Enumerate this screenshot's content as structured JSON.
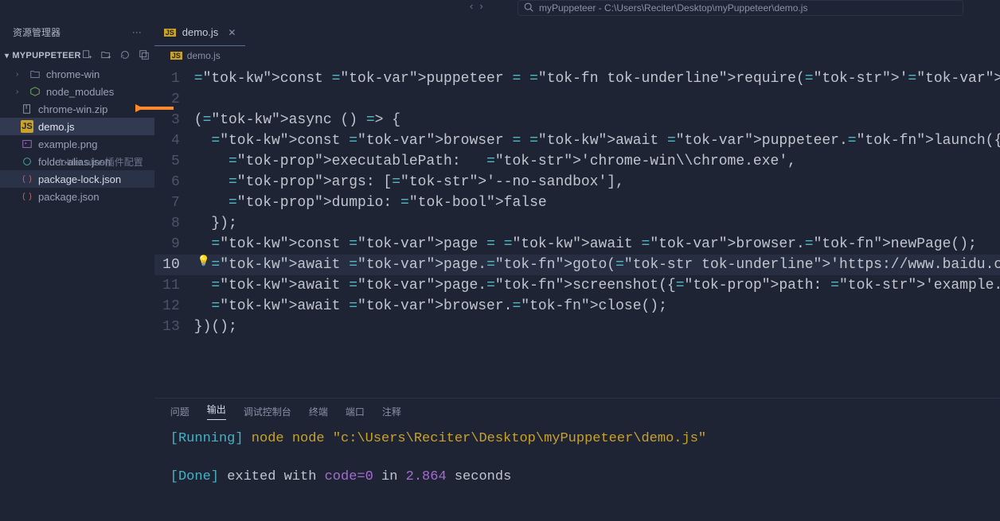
{
  "top": {
    "path_icon": "search-icon",
    "path_text": "myPuppeteer - C:\\Users\\Reciter\\Desktop\\myPuppeteer\\demo.js"
  },
  "sidebar": {
    "title": "资源管理器",
    "project": "MYPUPPETEER",
    "actions": [
      "new-file",
      "new-folder",
      "refresh",
      "collapse-all"
    ],
    "items": [
      {
        "type": "folder",
        "name": "chrome-win",
        "icon": "folder"
      },
      {
        "type": "folder",
        "name": "node_modules",
        "icon": "nm"
      },
      {
        "type": "file",
        "name": "chrome-win.zip",
        "icon": "zip",
        "annotated": true
      },
      {
        "type": "file",
        "name": "demo.js",
        "icon": "js",
        "selected": true
      },
      {
        "type": "file",
        "name": "example.png",
        "icon": "png"
      },
      {
        "type": "file",
        "name": "folder-alias.json",
        "icon": "json",
        "hint": "folder alias插件配置"
      },
      {
        "type": "file",
        "name": "package-lock.json",
        "icon": "json2",
        "active": true
      },
      {
        "type": "file",
        "name": "package.json",
        "icon": "json2"
      }
    ]
  },
  "tabs": {
    "open": [
      {
        "label": "demo.js",
        "icon": "js",
        "active": true
      }
    ]
  },
  "breadcrumb": {
    "icon": "js",
    "text": "demo.js"
  },
  "code": {
    "lines": [
      {
        "n": 1,
        "t": "const puppeteer = require('puppeteer');"
      },
      {
        "n": 2,
        "t": ""
      },
      {
        "n": 3,
        "t": "(async () => {"
      },
      {
        "n": 4,
        "t": "  const browser = await puppeteer.launch({"
      },
      {
        "n": 5,
        "t": "    executablePath:   'chrome-win\\\\chrome.exe',"
      },
      {
        "n": 6,
        "t": "    args: ['--no-sandbox'],"
      },
      {
        "n": 7,
        "t": "    dumpio: false"
      },
      {
        "n": 8,
        "t": "  });"
      },
      {
        "n": 9,
        "t": "  const page = await browser.newPage();"
      },
      {
        "n": 10,
        "t": "  await page.goto('https://www.baidu.com');",
        "highlight": true
      },
      {
        "n": 11,
        "t": "  await page.screenshot({path: 'example.png'});"
      },
      {
        "n": 12,
        "t": "  await browser.close();"
      },
      {
        "n": 13,
        "t": "})();"
      }
    ]
  },
  "panel": {
    "tabs": [
      "问题",
      "输出",
      "调试控制台",
      "终端",
      "端口",
      "注释"
    ],
    "active": 1,
    "output": {
      "running_label": "[Running]",
      "cmd": "node \"c:\\Users\\Reciter\\Desktop\\myPuppeteer\\demo.js\"",
      "done_label": "[Done]",
      "done_prefix": "exited with ",
      "code_label": "code=0",
      "done_mid": " in ",
      "time": "2.864",
      "done_suffix": " seconds"
    }
  }
}
